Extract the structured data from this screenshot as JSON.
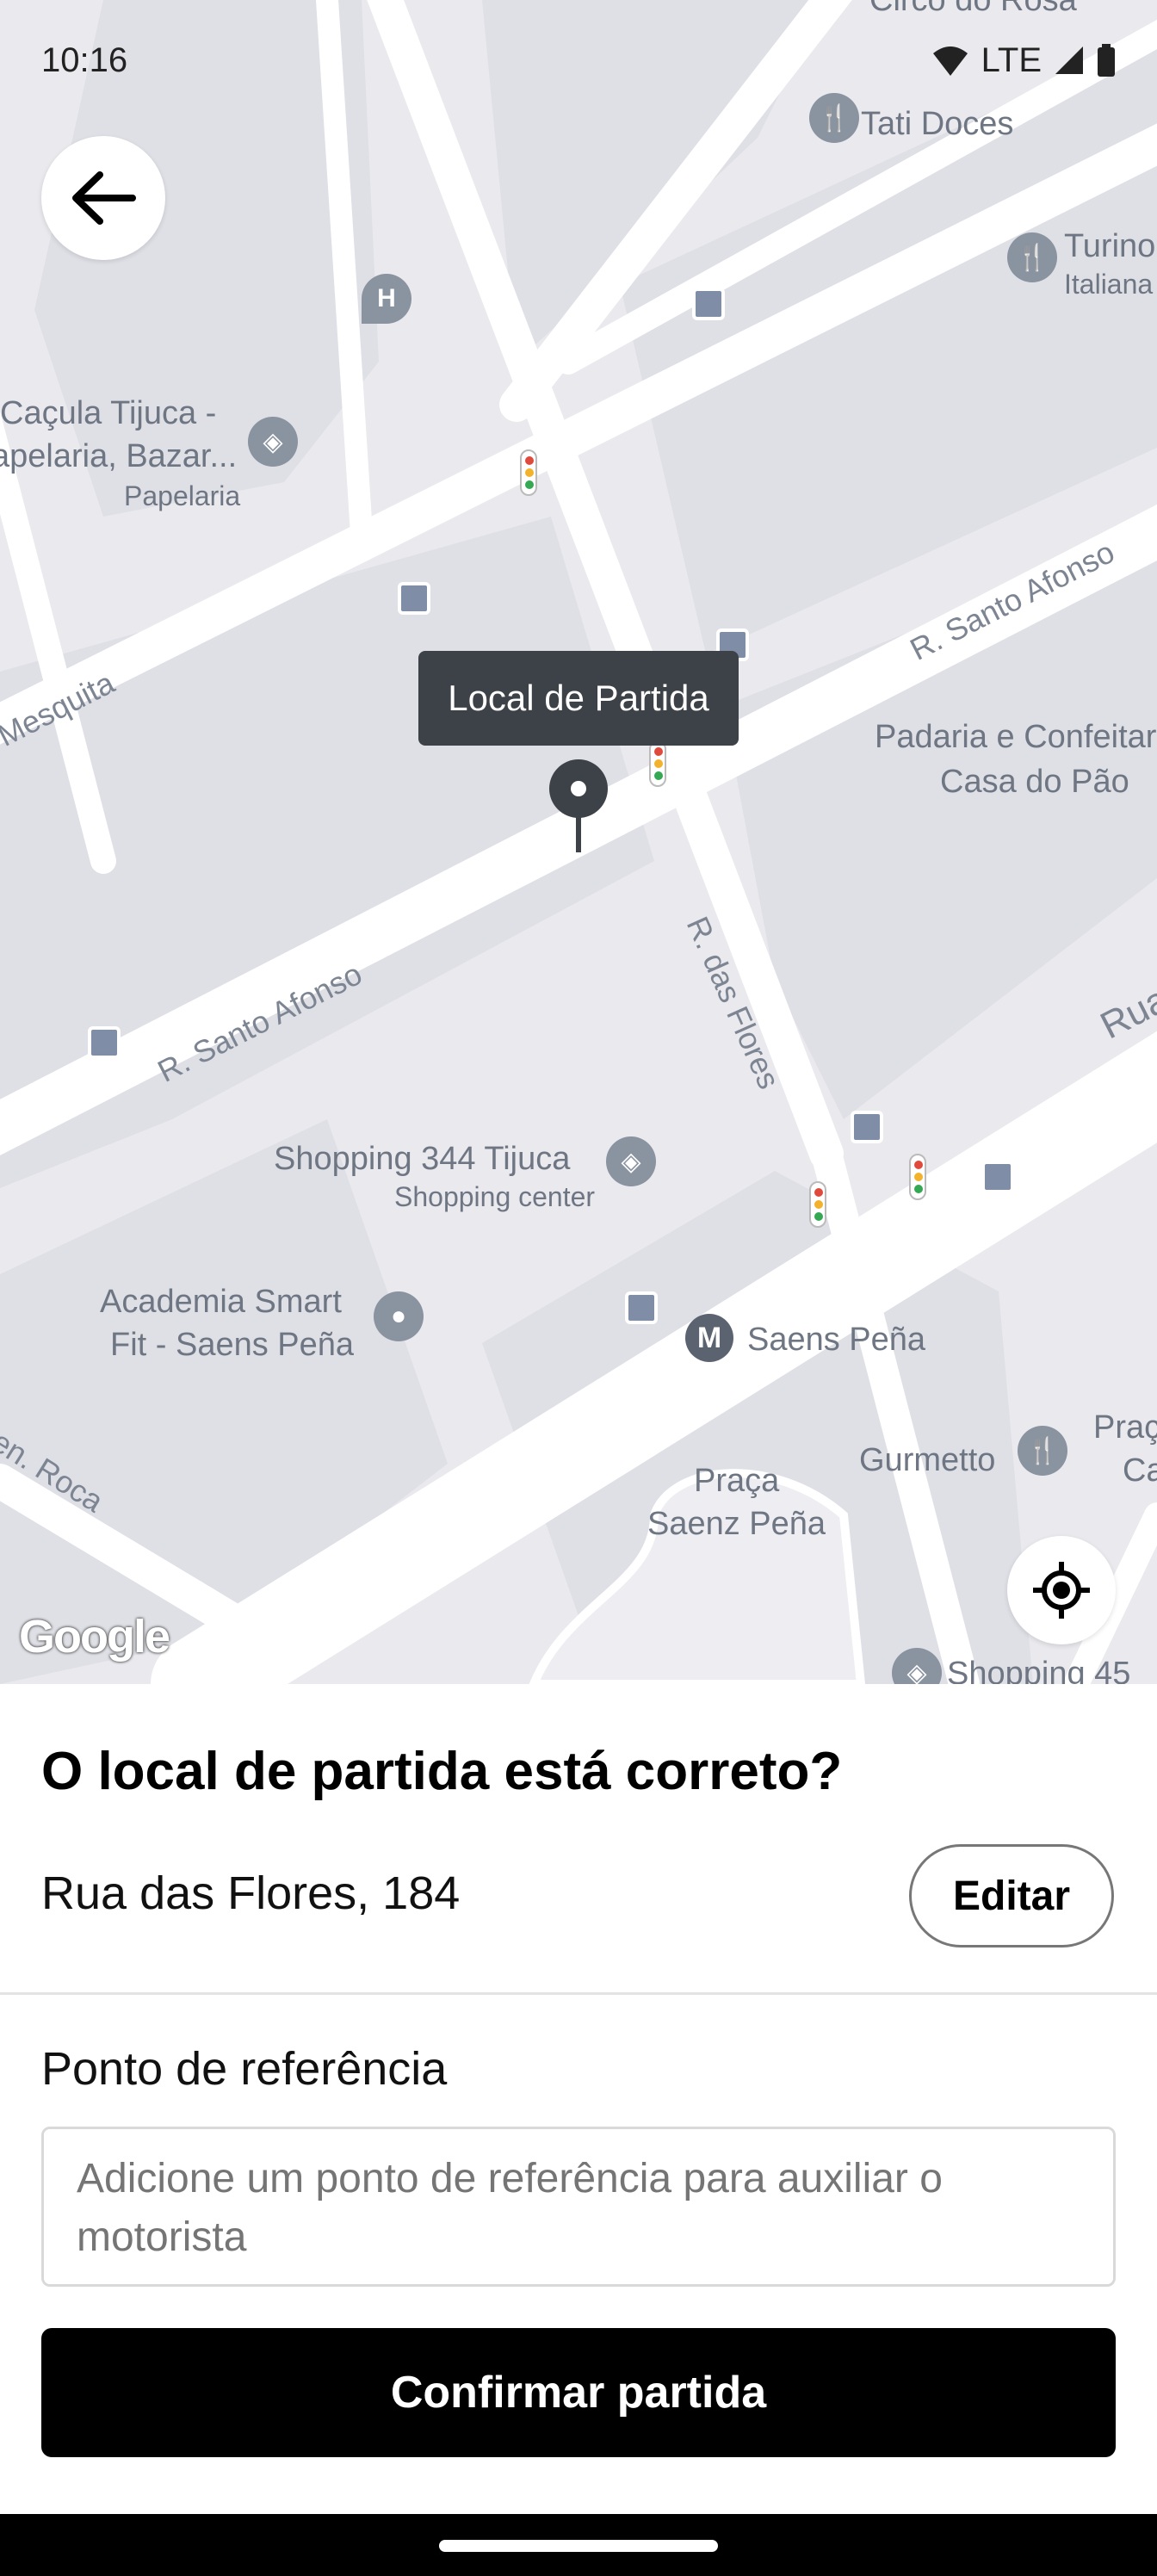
{
  "status_bar": {
    "time": "10:16",
    "network": "LTE"
  },
  "map": {
    "tooltip": "Local de Partida",
    "places": [
      {
        "name": "Tati Doces",
        "sub": ""
      },
      {
        "name": "Turino",
        "sub": "Italiana"
      },
      {
        "name": "Caçula Tijuca -",
        "name2": "apelaria, Bazar...",
        "sub": "Papelaria"
      },
      {
        "name": "Padaria e Confeitaria",
        "name2": "Casa do Pão"
      },
      {
        "name": "Shopping 344 Tijuca",
        "sub": "Shopping center"
      },
      {
        "name": "Academia Smart",
        "name2": "Fit - Saens Peña"
      },
      {
        "name": "Saens Peña"
      },
      {
        "name": "Gurmetto"
      },
      {
        "name": "Praça",
        "name2": "Saenz Peña"
      },
      {
        "name": "Shopping 45"
      },
      {
        "name": "Praç",
        "name2": "Ca"
      },
      {
        "name": "Circo do Rosa"
      }
    ],
    "streets": [
      "R. Santo Afonso",
      "R. Santo Afonso",
      "R. das Flores",
      "Mesquita",
      "en. Roca",
      "Rua"
    ],
    "attribution": "Google"
  },
  "sheet": {
    "question": "O local de partida está correto?",
    "address": "Rua das Flores, 184",
    "edit_label": "Editar",
    "reference_label": "Ponto de referência",
    "reference_placeholder": "Adicione um ponto de referência para auxiliar o motorista",
    "confirm_label": "Confirmar partida"
  },
  "colors": {
    "accent": "#000000",
    "map_bg": "#e9e9ee",
    "road": "#ffffff",
    "tooltip_bg": "#3d4148"
  }
}
